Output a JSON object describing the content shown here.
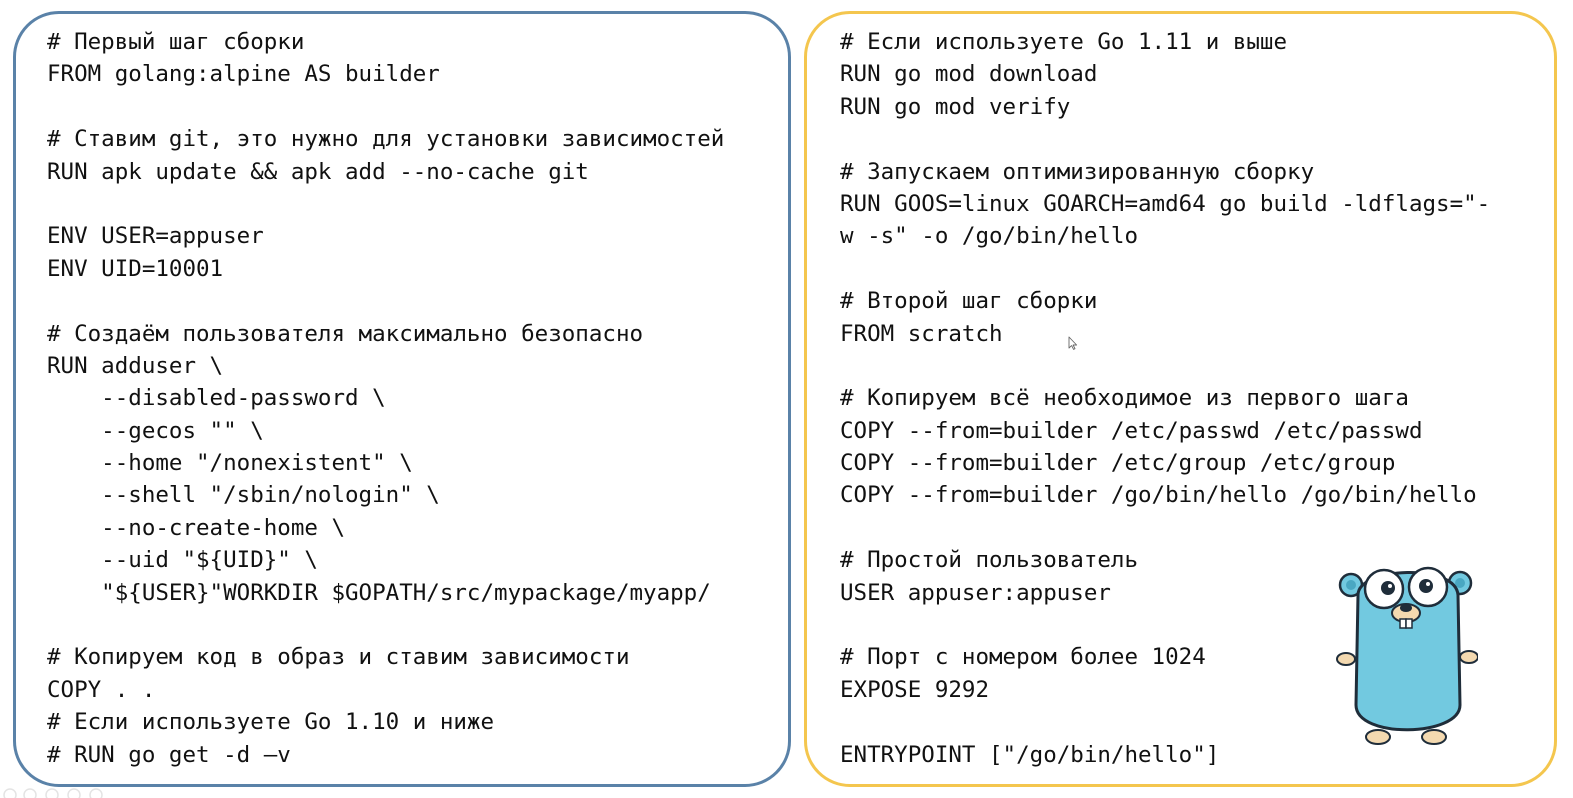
{
  "left_panel": {
    "border_color": "#5a82a8",
    "lines": [
      "# Первый шаг сборки",
      "FROM golang:alpine AS builder",
      "",
      "# Ставим git, это нужно для установки зависимостей",
      "RUN apk update && apk add --no-cache git",
      "",
      "ENV USER=appuser",
      "ENV UID=10001",
      "",
      "# Создаём пользователя максимально безопасно",
      "RUN adduser \\",
      "    --disabled-password \\",
      "    --gecos \"\" \\",
      "    --home \"/nonexistent\" \\",
      "    --shell \"/sbin/nologin\" \\",
      "    --no-create-home \\",
      "    --uid \"${UID}\" \\",
      "    \"${USER}\"WORKDIR $GOPATH/src/mypackage/myapp/",
      "",
      "# Копируем код в образ и ставим зависимости",
      "COPY . .",
      "# Если используете Go 1.10 и ниже",
      "# RUN go get -d –v"
    ]
  },
  "right_panel": {
    "border_color": "#f4c64e",
    "lines": [
      "# Если используете Go 1.11 и выше",
      "RUN go mod download",
      "RUN go mod verify",
      "",
      "# Запускаем оптимизированную сборку",
      "RUN GOOS=linux GOARCH=amd64 go build -ldflags=\"-",
      "w -s\" -o /go/bin/hello",
      "",
      "# Второй шаг сборки",
      "FROM scratch",
      "",
      "# Копируем всё необходимое из первого шага",
      "COPY --from=builder /etc/passwd /etc/passwd",
      "COPY --from=builder /etc/group /etc/group",
      "COPY --from=builder /go/bin/hello /go/bin/hello",
      "",
      "# Простой пользователь",
      "USER appuser:appuser",
      "",
      "# Порт с номером более 1024",
      "EXPOSE 9292",
      "",
      "ENTRYPOINT [\"/go/bin/hello\"]"
    ]
  },
  "icons": {
    "mascot": "go-gopher-mascot-icon",
    "cursor": "mouse-pointer-icon"
  },
  "colors": {
    "gopher_body": "#72c9e0",
    "gopher_outline": "#1f2d3a",
    "gopher_paw": "#f3d9b0"
  }
}
